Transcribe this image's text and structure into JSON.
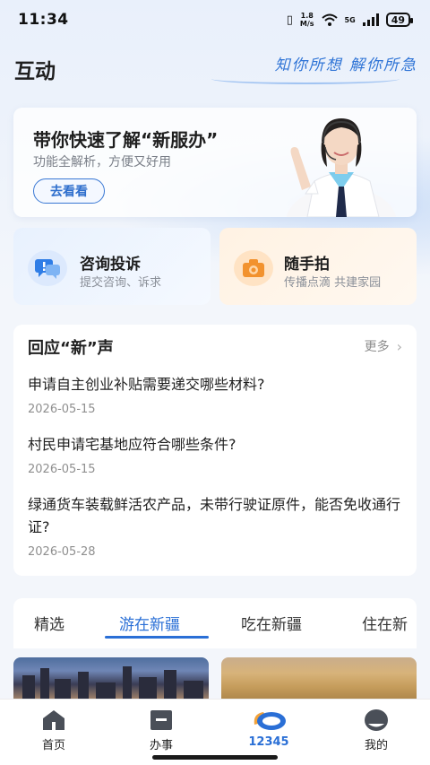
{
  "status_bar": {
    "time": "11:34",
    "net_speed_top": "1.8",
    "net_speed_bottom": "M/s",
    "network": "5G",
    "battery": "49"
  },
  "header": {
    "title": "互动",
    "slogan": "知你所想  解你所急"
  },
  "banner": {
    "title": "带你快速了解“新服办”",
    "subtitle": "功能全解析，方便又好用",
    "button": "去看看"
  },
  "quick_cards": [
    {
      "title": "咨询投诉",
      "subtitle": "提交咨询、诉求",
      "icon": "chat-icon"
    },
    {
      "title": "随手拍",
      "subtitle": "传播点滴 共建家园",
      "icon": "camera-icon"
    }
  ],
  "responses": {
    "title": "回应“新”声",
    "more": "更多",
    "items": [
      {
        "question": "申请自主创业补贴需要递交哪些材料?",
        "date": "2026-05-15"
      },
      {
        "question": "村民申请宅基地应符合哪些条件?",
        "date": "2026-05-15"
      },
      {
        "question": "绿通货车装载鲜活农产品，未带行驶证原件，能否免收通行证?",
        "date": "2026-05-28"
      }
    ]
  },
  "tabs": {
    "items": [
      "精选",
      "游在新疆",
      "吃在新疆",
      "住在新"
    ],
    "active": "游在新疆"
  },
  "bottom_nav": {
    "items": [
      {
        "label": "首页",
        "icon": "home-icon"
      },
      {
        "label": "办事",
        "icon": "tasks-icon"
      },
      {
        "label": "12345",
        "icon": "hotline-icon"
      },
      {
        "label": "我的",
        "icon": "profile-icon"
      }
    ]
  },
  "colors": {
    "accent": "#2a6fd6",
    "background": "#f3f6fb"
  }
}
